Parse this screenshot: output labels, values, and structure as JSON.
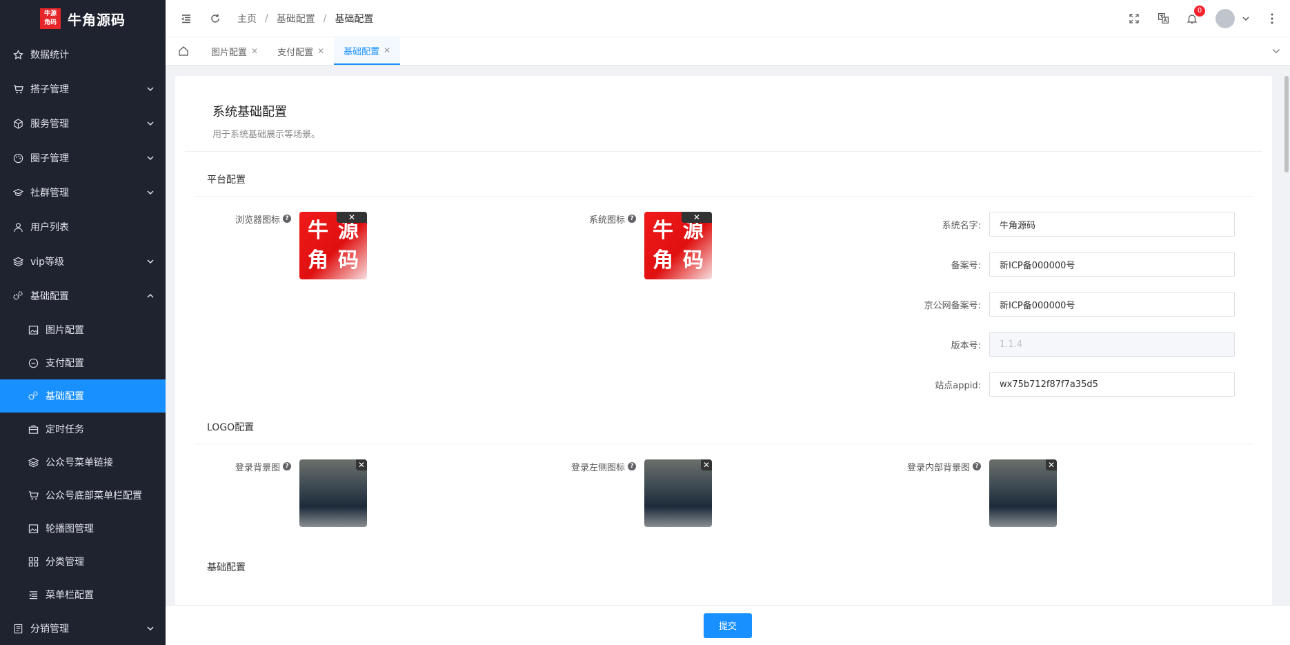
{
  "app": {
    "logo_chars": [
      "牛",
      "源",
      "角",
      "码"
    ],
    "logo_text": "牛角源码"
  },
  "sidebar": {
    "items": [
      {
        "label": "数据统计",
        "icon": "star-icon",
        "arrow": ""
      },
      {
        "label": "搭子管理",
        "icon": "cart-icon",
        "arrow": "down"
      },
      {
        "label": "服务管理",
        "icon": "cube-icon",
        "arrow": "down"
      },
      {
        "label": "圈子管理",
        "icon": "palette-icon",
        "arrow": "down"
      },
      {
        "label": "社群管理",
        "icon": "graduation-icon",
        "arrow": "down"
      },
      {
        "label": "用户列表",
        "icon": "user-icon",
        "arrow": ""
      },
      {
        "label": "vip等级",
        "icon": "layers-icon",
        "arrow": "down"
      },
      {
        "label": "基础配置",
        "icon": "gears-icon",
        "arrow": "up"
      }
    ],
    "submenu": [
      {
        "label": "图片配置",
        "icon": "image-icon"
      },
      {
        "label": "支付配置",
        "icon": "minus-circle-icon"
      },
      {
        "label": "基础配置",
        "icon": "gears-icon",
        "active": true
      },
      {
        "label": "定时任务",
        "icon": "briefcase-icon"
      },
      {
        "label": "公众号菜单链接",
        "icon": "layers-icon"
      },
      {
        "label": "公众号底部菜单栏配置",
        "icon": "cart-icon"
      },
      {
        "label": "轮播图管理",
        "icon": "image-icon"
      },
      {
        "label": "分类管理",
        "icon": "grid-icon"
      },
      {
        "label": "菜单栏配置",
        "icon": "list-icon"
      }
    ],
    "last": {
      "label": "分销管理",
      "icon": "doc-icon",
      "arrow": "down"
    }
  },
  "header": {
    "breadcrumb": [
      "主页",
      "基础配置",
      "基础配置"
    ],
    "notification_count": "0"
  },
  "tabs": [
    {
      "label": "图片配置",
      "active": false
    },
    {
      "label": "支付配置",
      "active": false
    },
    {
      "label": "基础配置",
      "active": true
    }
  ],
  "page": {
    "title": "系统基础配置",
    "description": "用于系统基础展示等场景。"
  },
  "platform": {
    "section_title": "平台配置",
    "browser_icon_label": "浏览器图标",
    "system_icon_label": "系统图标",
    "fields": [
      {
        "label": "系统名字:",
        "value": "牛角源码",
        "disabled": false
      },
      {
        "label": "备案号:",
        "value": "新ICP备000000号",
        "disabled": false
      },
      {
        "label": "京公网备案号:",
        "value": "新ICP备000000号",
        "disabled": false
      },
      {
        "label": "版本号:",
        "value": "1.1.4",
        "disabled": true
      },
      {
        "label": "站点appid:",
        "value": "wx75b712f87f7a35d5",
        "disabled": false
      }
    ]
  },
  "logo_section": {
    "section_title": "LOGO配置",
    "login_bg_label": "登录背景图",
    "login_left_label": "登录左侧图标",
    "login_inner_bg_label": "登录内部背景图"
  },
  "basic_section": {
    "section_title": "基础配置"
  },
  "footer": {
    "submit_label": "提交"
  },
  "colors": {
    "primary": "#1890ff",
    "sidebar_bg": "#1f2330"
  }
}
